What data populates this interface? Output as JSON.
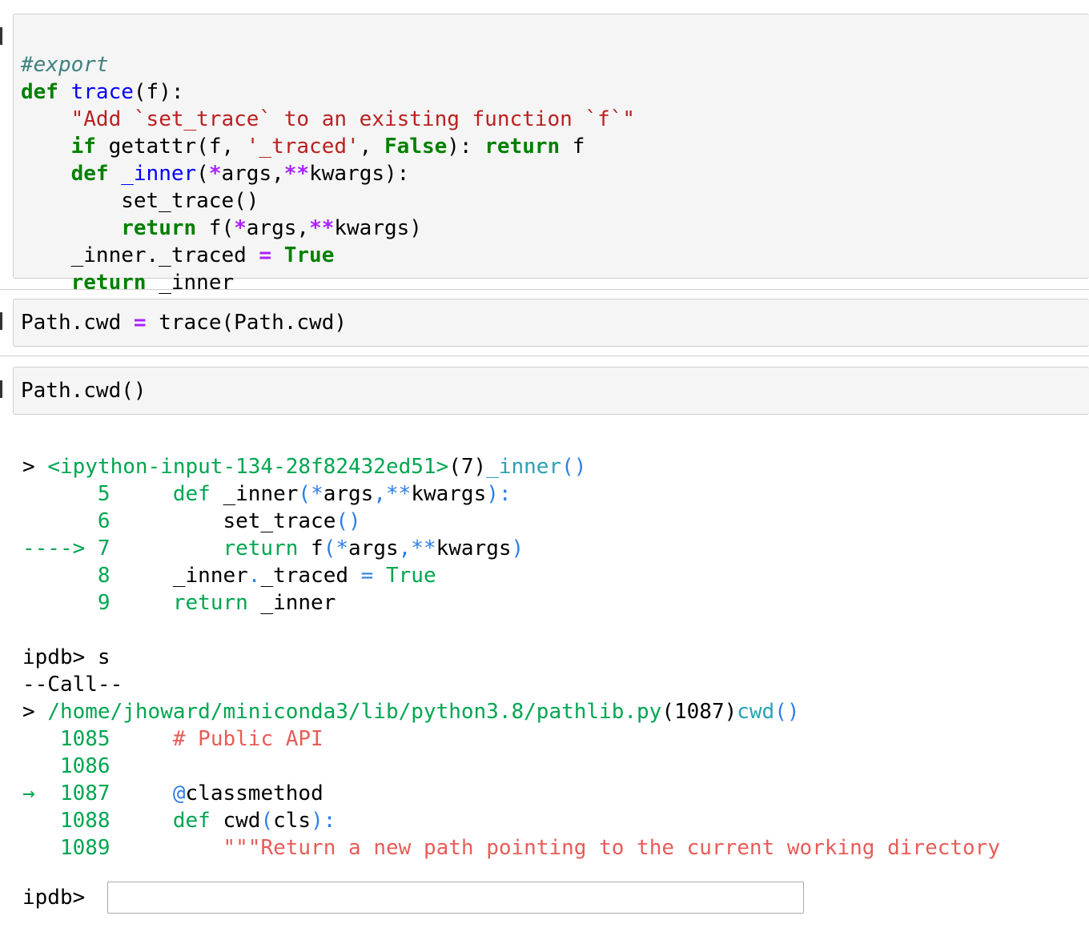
{
  "cells": [
    {
      "lines": [
        [
          "#export"
        ],
        [
          "def",
          " ",
          "trace",
          "(f):"
        ],
        [
          "    ",
          "\"Add `set_trace` to an existing function `f`\""
        ],
        [
          "    ",
          "if",
          " getattr(f, ",
          "'_traced'",
          ", ",
          "False",
          "): ",
          "return",
          " f"
        ],
        [
          "    ",
          "def",
          " ",
          "_inner",
          "(",
          "*",
          "args,",
          "**",
          "kwargs):"
        ],
        [
          "        set_trace()"
        ],
        [
          "        ",
          "return",
          " f(",
          "*",
          "args,",
          "**",
          "kwargs)"
        ],
        [
          "    _inner._traced ",
          "=",
          " ",
          "True"
        ],
        [
          "    ",
          "return",
          " _inner"
        ]
      ]
    },
    {
      "code": [
        "Path.cwd ",
        "=",
        " trace(Path.cwd)"
      ]
    },
    {
      "code": "Path.cwd()"
    }
  ],
  "output": {
    "frame1": {
      "arrow": "> ",
      "file": "<ipython-input-134-28f82432ed51>",
      "lineno": "(7)",
      "func": "_inner",
      "parens": "()"
    },
    "listing1": [
      {
        "marker": "      ",
        "num": "5",
        "code": [
          "def",
          " _inner",
          "(",
          "*",
          "args",
          ",",
          "**",
          "kwargs",
          "):"
        ]
      },
      {
        "marker": "      ",
        "num": "6",
        "code": [
          "set_trace",
          "()"
        ]
      },
      {
        "marker": "----> ",
        "num": "7",
        "code": [
          "return",
          " f",
          "(",
          "*",
          "args",
          ",",
          "**",
          "kwargs",
          ")"
        ]
      },
      {
        "marker": "      ",
        "num": "8",
        "code": [
          "_inner",
          ".",
          "_traced ",
          "=",
          " ",
          "True"
        ]
      },
      {
        "marker": "      ",
        "num": "9",
        "code": [
          "return",
          " _inner"
        ]
      }
    ],
    "ipdb_prompt": "ipdb> ",
    "command": "s",
    "call_line": "--Call--",
    "frame2": {
      "arrow": "> ",
      "file": "/home/jhoward/miniconda3/lib/python3.8/pathlib.py",
      "lineno": "(1087)",
      "func": "cwd",
      "parens": "()"
    },
    "listing2": [
      {
        "marker": "   ",
        "num": "1085",
        "code": [
          "# Public API"
        ]
      },
      {
        "marker": "   ",
        "num": "1086",
        "code": [
          ""
        ]
      },
      {
        "marker": "→  ",
        "num": "1087",
        "code": [
          "@",
          "classmethod"
        ]
      },
      {
        "marker": "   ",
        "num": "1088",
        "code": [
          "def",
          " cwd",
          "(",
          "cls",
          "):"
        ]
      },
      {
        "marker": "   ",
        "num": "1089",
        "code": [
          "\"\"\"Return a new path pointing to the current working directory"
        ]
      }
    ],
    "input_prompt": "ipdb> ",
    "input_value": ""
  }
}
